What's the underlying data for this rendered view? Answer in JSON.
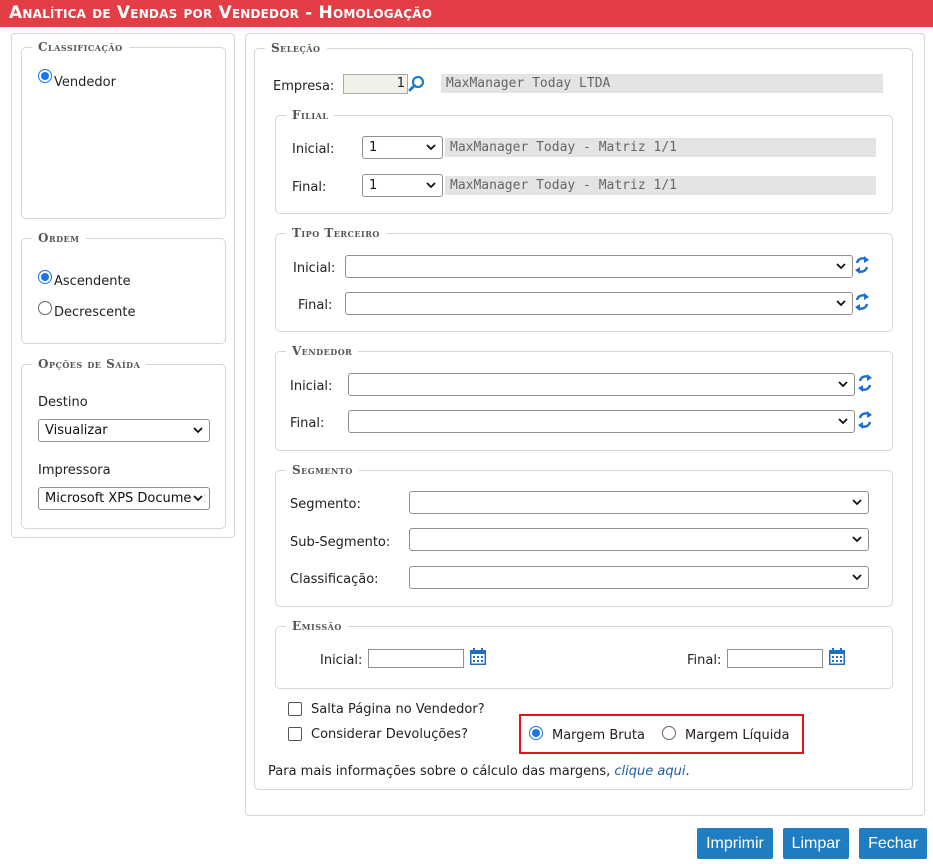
{
  "title": "Analítica de Vendas por Vendedor  - Homologação",
  "classificacao": {
    "legend": "Classificação",
    "options": [
      {
        "label": "Vendedor",
        "checked": true
      }
    ]
  },
  "ordem": {
    "legend": "Ordem",
    "options": [
      {
        "label": "Ascendente",
        "checked": true
      },
      {
        "label": "Decrescente",
        "checked": false
      }
    ]
  },
  "saida": {
    "legend": "Opções de Saída",
    "destino_label": "Destino",
    "destino_value": "Visualizar",
    "impressora_label": "Impressora",
    "impressora_value": "Microsoft XPS Document Writer"
  },
  "selecao": {
    "legend": "Seleção",
    "empresa_label": "Empresa:",
    "empresa_code": "1",
    "empresa_name": "MaxManager Today LTDA",
    "filial": {
      "legend": "Filial",
      "inicial_label": "Inicial:",
      "inicial_value": "1",
      "inicial_name": "MaxManager Today - Matriz 1/1",
      "final_label": "Final:",
      "final_value": "1",
      "final_name": "MaxManager Today - Matriz 1/1"
    },
    "tipo_terceiro": {
      "legend": "Tipo Terceiro",
      "inicial_label": "Inicial:",
      "final_label": "Final:"
    },
    "vendedor": {
      "legend": "Vendedor",
      "inicial_label": "Inicial:",
      "final_label": "Final:"
    },
    "segmento": {
      "legend": "Segmento",
      "segmento_label": "Segmento:",
      "subsegmento_label": "Sub-Segmento:",
      "classificacao_label": "Classificação:"
    },
    "emissao": {
      "legend": "Emissão",
      "inicial_label": "Inicial:",
      "final_label": "Final:"
    },
    "salta_pagina_label": "Salta Página no Vendedor?",
    "considerar_devolucoes_label": "Considerar Devoluções?",
    "margem_bruta_label": "Margem Bruta",
    "margem_liquida_label": "Margem Líquida",
    "margem_selected": "Margem Bruta",
    "info_text": "Para mais informações sobre o cálculo das margens, ",
    "info_link": "clique aqui",
    "info_end": "."
  },
  "buttons": {
    "imprimir": "Imprimir",
    "limpar": "Limpar",
    "fechar": "Fechar"
  },
  "colors": {
    "title_bar": "#e33d46",
    "button": "#1f7ec1",
    "accent": "#1a73e8",
    "highlight": "#e0151e"
  }
}
